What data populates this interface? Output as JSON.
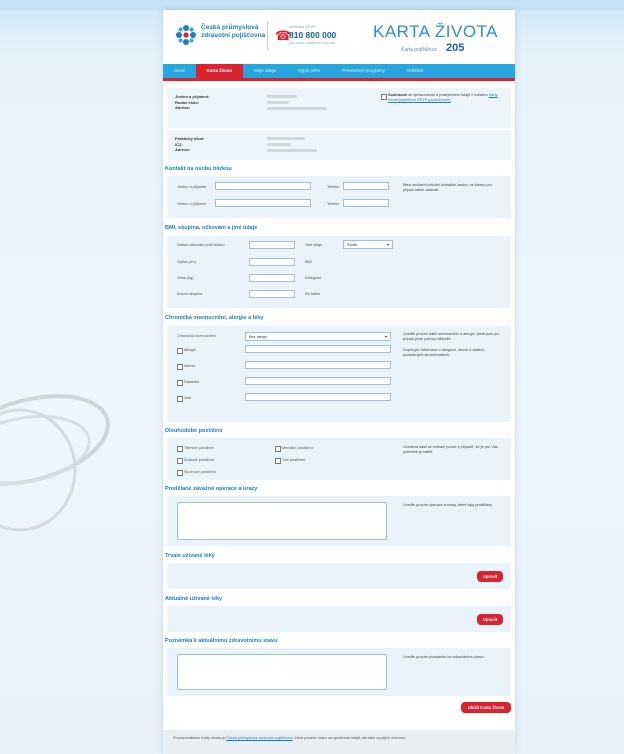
{
  "header": {
    "logo_line1": "Česká průmyslová",
    "logo_line2": "zdravotní pojišťovna",
    "phone_caption": "Infolinka ČPZP",
    "phone_number": "810 800 000",
    "phone_note": "(za cenu místního hovoru)",
    "title": "KARTA ŽIVOTA",
    "card_no_label": "Karta pojištěnce",
    "card_no": "205"
  },
  "nav": {
    "tabs": [
      "Úvod",
      "Karta života",
      "Moje údaje",
      "Výpis péče",
      "Preventivní programy",
      "Odhlásit"
    ]
  },
  "insured": {
    "labels": [
      "Jméno a příjmení:",
      "Rodné číslo:",
      "Adresa:"
    ],
    "consent_title": "Souhlasím",
    "consent_text": "se zpracováním a poskytnutím údajů v rozsahu",
    "consent_link": "Karty života pojištěnce ČPZP (podrobnosti)"
  },
  "doctor": {
    "labels": [
      "Praktický lékař:",
      "IČZ:",
      "Adresa:"
    ]
  },
  "contacts": {
    "title": "Kontakt na osobu blízkou",
    "name_label": "Jméno a příjmení",
    "phone_label": "Telefon",
    "note": "Mezi osobami přivolat kontaktní osobu, ve kterou pro případ náhle události."
  },
  "blood": {
    "title": "BMI, skupina, očkování a jiné údaje",
    "rows": [
      {
        "label": "Datum očkování proti tetanu",
        "right_label": "Jiné údaje"
      },
      {
        "label": "Výška (cm)",
        "unit": "BMI"
      },
      {
        "label": "Váha (kg)",
        "unit": "Kategorie"
      },
      {
        "label": "Krevní skupina",
        "unit": "Rh faktor"
      }
    ],
    "select_value": "Zvolte"
  },
  "chronic": {
    "title": "Chronická onemocnění, alergie a léky",
    "select_label": "Chronická onemocnění",
    "select_value": "Bez alergií",
    "checks": [
      "Alergie",
      "Astma",
      "Diabetes",
      "Jiné"
    ],
    "note1": "Uveďte prosím další onemocnění a alergie, které jsou pro případ první pomoci důležité.",
    "note2": "Doplňující informace o alergiích, lécích a dalších podstatných skutečnostech."
  },
  "disability": {
    "title": "Dlouhodobé postižení",
    "checks_left": [
      "Tělesné postižení",
      "Zrakové postižení",
      "Sluchové postižení"
    ],
    "checks_right": [
      "Mentální postižení",
      "Jiné postižení"
    ],
    "note": "Uvedená data se zobrazí pouze v případě, že je pro Vás potřebné je sdělit."
  },
  "history": {
    "title": "Prodělané závažné operace a úrazy",
    "note": "Uveďte prosím operace a úrazy, které byly prodělány."
  },
  "meds_current": {
    "title": "Trvale užívané léky",
    "button": "Upravit"
  },
  "meds_now": {
    "title": "Aktuálně užívané léky",
    "button": "Upravit"
  },
  "notes": {
    "title": "Poznámka k aktuálnímu zdravotnímu stavu",
    "note": "Uveďte prosím poznámku ke zdravotnímu stavu.",
    "save_button": "Uložit Kartu života"
  },
  "footer": {
    "text": "Provozovatelem Karty života je",
    "link": "Česká průmyslová zdravotní pojišťovna",
    "text2": ", která ponese nejen za správnost údajů, ale také za jejich ochranu."
  }
}
